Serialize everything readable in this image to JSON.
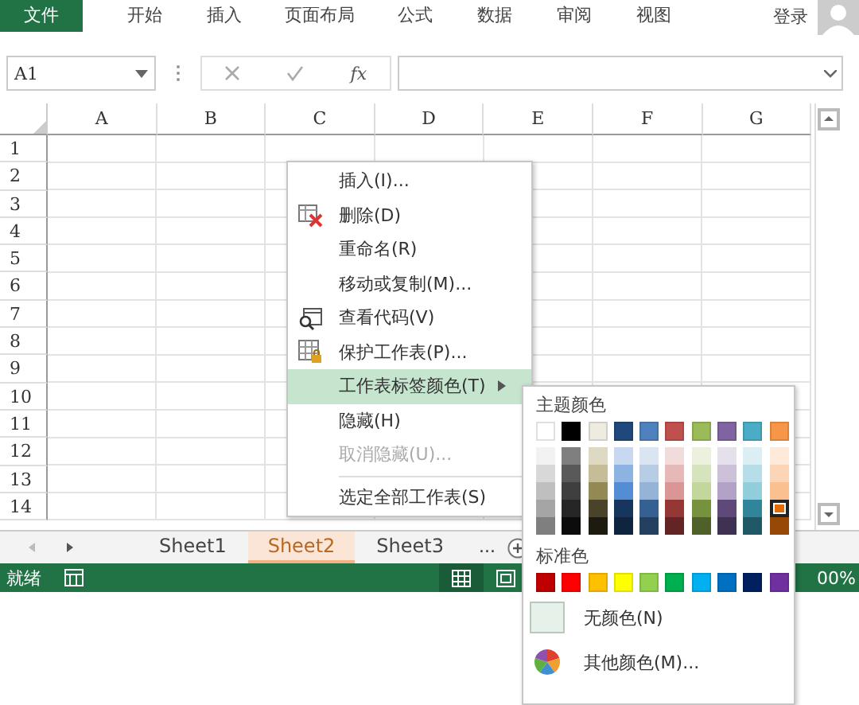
{
  "ribbon": {
    "tabs": [
      {
        "label": "文件",
        "selected": true
      },
      {
        "label": "开始",
        "selected": false
      },
      {
        "label": "插入",
        "selected": false
      },
      {
        "label": "页面布局",
        "selected": false
      },
      {
        "label": "公式",
        "selected": false
      },
      {
        "label": "数据",
        "selected": false
      },
      {
        "label": "审阅",
        "selected": false
      },
      {
        "label": "视图",
        "selected": false
      }
    ],
    "sign_in": "登录"
  },
  "formula_bar": {
    "name_box": "A1",
    "fx": "fx"
  },
  "sheet": {
    "columns": [
      "A",
      "B",
      "C",
      "D",
      "E",
      "F",
      "G"
    ],
    "rows": [
      "1",
      "2",
      "3",
      "4",
      "5",
      "6",
      "7",
      "8",
      "9",
      "10",
      "11",
      "12",
      "13",
      "14"
    ]
  },
  "sheet_tabs": {
    "tabs": [
      {
        "label": "Sheet1",
        "selected": false
      },
      {
        "label": "Sheet2",
        "selected": true,
        "color": "#f4b183"
      },
      {
        "label": "Sheet3",
        "selected": false
      }
    ],
    "more": "..."
  },
  "status_bar": {
    "ready": "就绪",
    "views": [
      {
        "selected": true
      },
      {
        "selected": false
      }
    ],
    "zoom": "00%"
  },
  "context_menu": {
    "items": [
      {
        "kind": "item",
        "label": "插入(I)...",
        "selected": false,
        "disabled": false
      },
      {
        "kind": "item",
        "label": "删除(D)",
        "selected": false,
        "disabled": false
      },
      {
        "kind": "item",
        "label": "重命名(R)",
        "selected": false,
        "disabled": false
      },
      {
        "kind": "item",
        "label": "移动或复制(M)...",
        "selected": false,
        "disabled": false
      },
      {
        "kind": "item",
        "label": "查看代码(V)",
        "selected": false,
        "disabled": false
      },
      {
        "kind": "item",
        "label": "保护工作表(P)...",
        "selected": false,
        "disabled": false
      },
      {
        "kind": "item",
        "label": "工作表标签颜色(T)",
        "submenu": true,
        "selected": true,
        "disabled": false
      },
      {
        "kind": "item",
        "label": "隐藏(H)",
        "selected": false,
        "disabled": false
      },
      {
        "kind": "item",
        "label": "取消隐藏(U)...",
        "selected": false,
        "disabled": true
      },
      {
        "kind": "separator"
      },
      {
        "kind": "item",
        "label": "选定全部工作表(S)",
        "selected": false,
        "disabled": false
      }
    ]
  },
  "color_menu": {
    "theme_title": "主题颜色",
    "theme_base": [
      {
        "color": "#ffffff",
        "selected": false
      },
      {
        "color": "#000000",
        "selected": false
      },
      {
        "color": "#eeece1",
        "selected": false
      },
      {
        "color": "#1f497d",
        "selected": false
      },
      {
        "color": "#4f81bd",
        "selected": false
      },
      {
        "color": "#c0504d",
        "selected": false
      },
      {
        "color": "#9bbb59",
        "selected": false
      },
      {
        "color": "#8064a2",
        "selected": false
      },
      {
        "color": "#4bacc6",
        "selected": false
      },
      {
        "color": "#f79646",
        "selected": false
      }
    ],
    "theme_shades": [
      [
        {
          "color": "#f2f2f2",
          "selected": false
        },
        {
          "color": "#7f7f7f",
          "selected": false
        },
        {
          "color": "#ddd9c3",
          "selected": false
        },
        {
          "color": "#c6d9f0",
          "selected": false
        },
        {
          "color": "#dbe5f1",
          "selected": false
        },
        {
          "color": "#f2dcdb",
          "selected": false
        },
        {
          "color": "#ebf1dd",
          "selected": false
        },
        {
          "color": "#e5e0ec",
          "selected": false
        },
        {
          "color": "#dbeef3",
          "selected": false
        },
        {
          "color": "#fdeada",
          "selected": false
        }
      ],
      [
        {
          "color": "#d8d8d8",
          "selected": false
        },
        {
          "color": "#595959",
          "selected": false
        },
        {
          "color": "#c4bd97",
          "selected": false
        },
        {
          "color": "#8db3e2",
          "selected": false
        },
        {
          "color": "#b8cce4",
          "selected": false
        },
        {
          "color": "#e5b9b7",
          "selected": false
        },
        {
          "color": "#d7e3bc",
          "selected": false
        },
        {
          "color": "#ccc1d9",
          "selected": false
        },
        {
          "color": "#b7dde8",
          "selected": false
        },
        {
          "color": "#fbd5b5",
          "selected": false
        }
      ],
      [
        {
          "color": "#bfbfbf",
          "selected": false
        },
        {
          "color": "#3f3f3f",
          "selected": false
        },
        {
          "color": "#938953",
          "selected": false
        },
        {
          "color": "#548dd4",
          "selected": false
        },
        {
          "color": "#95b3d7",
          "selected": false
        },
        {
          "color": "#d99694",
          "selected": false
        },
        {
          "color": "#c3d69b",
          "selected": false
        },
        {
          "color": "#b2a2c7",
          "selected": false
        },
        {
          "color": "#92cddc",
          "selected": false
        },
        {
          "color": "#fac08f",
          "selected": false
        }
      ],
      [
        {
          "color": "#a5a5a5",
          "selected": false
        },
        {
          "color": "#262626",
          "selected": false
        },
        {
          "color": "#494429",
          "selected": false
        },
        {
          "color": "#17365d",
          "selected": false
        },
        {
          "color": "#366092",
          "selected": false
        },
        {
          "color": "#953734",
          "selected": false
        },
        {
          "color": "#76923c",
          "selected": false
        },
        {
          "color": "#5f497a",
          "selected": false
        },
        {
          "color": "#31859b",
          "selected": false
        },
        {
          "color": "#e36c09",
          "selected": true
        }
      ],
      [
        {
          "color": "#7f7f7f",
          "selected": false
        },
        {
          "color": "#0c0c0c",
          "selected": false
        },
        {
          "color": "#1d1b10",
          "selected": false
        },
        {
          "color": "#0f243e",
          "selected": false
        },
        {
          "color": "#244061",
          "selected": false
        },
        {
          "color": "#632423",
          "selected": false
        },
        {
          "color": "#4f6128",
          "selected": false
        },
        {
          "color": "#3f3151",
          "selected": false
        },
        {
          "color": "#205867",
          "selected": false
        },
        {
          "color": "#974806",
          "selected": false
        }
      ]
    ],
    "standard_title": "标准色",
    "standard": [
      {
        "color": "#c00000",
        "selected": false
      },
      {
        "color": "#ff0000",
        "selected": false
      },
      {
        "color": "#ffc000",
        "selected": false
      },
      {
        "color": "#ffff00",
        "selected": false
      },
      {
        "color": "#92d050",
        "selected": false
      },
      {
        "color": "#00b050",
        "selected": false
      },
      {
        "color": "#00b0f0",
        "selected": false
      },
      {
        "color": "#0070c0",
        "selected": false
      },
      {
        "color": "#002060",
        "selected": false
      },
      {
        "color": "#7030a0",
        "selected": false
      }
    ],
    "no_color": "无颜色(N)",
    "more_colors": "其他颜色(M)..."
  }
}
